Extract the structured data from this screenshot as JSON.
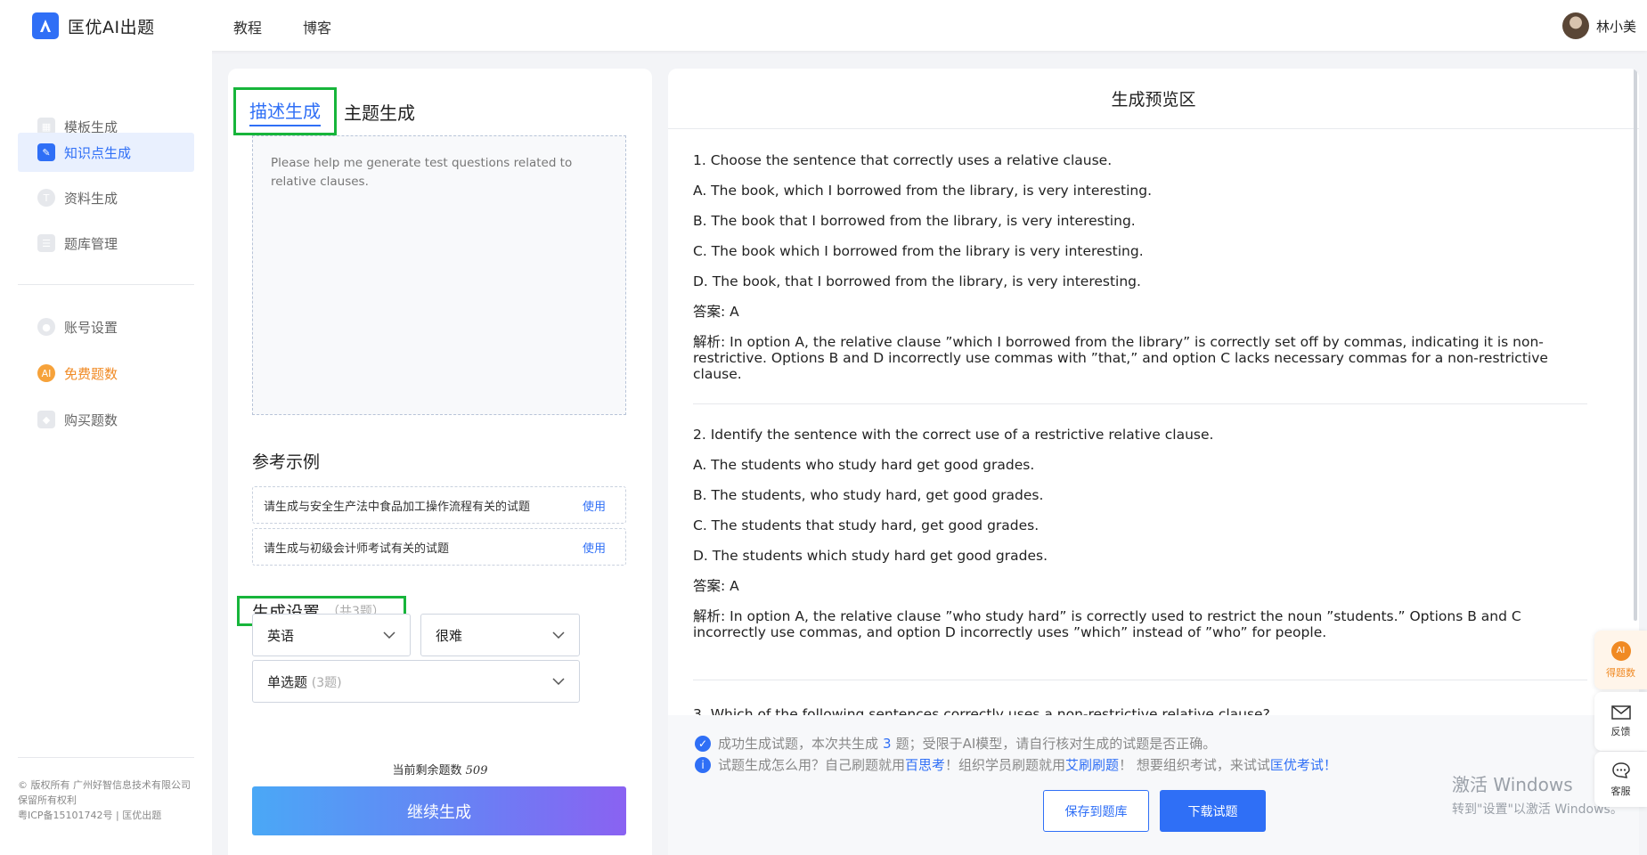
{
  "brand": {
    "name": "匡优AI出题",
    "color": "#2f6ff6"
  },
  "nav": {
    "items": [
      "教程",
      "博客"
    ]
  },
  "user": {
    "name": "林小美"
  },
  "sidebar": {
    "items": [
      {
        "label": "模板生成",
        "icon": "template-icon"
      },
      {
        "label": "知识点生成",
        "icon": "edit-icon"
      },
      {
        "label": "资料生成",
        "icon": "document-icon"
      },
      {
        "label": "题库管理",
        "icon": "database-icon"
      },
      {
        "label": "账号设置",
        "icon": "user-icon"
      },
      {
        "label": "免费题数",
        "icon": "ai-coin-icon"
      },
      {
        "label": "购买题数",
        "icon": "diamond-icon"
      }
    ],
    "copyright": [
      "© 版权所有 广州好智信息技术有限公司",
      "保留所有权利",
      "粤ICP备15101742号 | 匡优出题"
    ]
  },
  "left": {
    "tab_active": "描述生成",
    "tab_other": "主题生成",
    "description": "Please help me generate test questions related to relative clauses.",
    "examples_title": "参考示例",
    "examples": [
      {
        "text": "请生成与安全生产法中食品加工操作流程有关的试题",
        "action": "使用"
      },
      {
        "text": "请生成与初级会计师考试有关的试题",
        "action": "使用"
      }
    ],
    "settings_title": "生成设置",
    "settings_count": "（共3题）",
    "language": "英语",
    "difficulty": "很难",
    "qtype": "单选题",
    "qtype_count": "(3题)",
    "remain_label": "当前剩余题数",
    "remain_value": "509",
    "generate_button": "继续生成"
  },
  "preview": {
    "title": "生成预览区",
    "questions": [
      {
        "stem": "1. Choose the sentence that correctly uses a relative clause.",
        "options": [
          "A. The book, which I borrowed from the library, is very interesting.",
          "B. The book that I borrowed from the library, is very interesting.",
          "C. The book which I borrowed from the library is very interesting.",
          "D. The book, that I borrowed from the library, is very interesting."
        ],
        "answer": "答案: A",
        "explanation": "解析: In option A, the relative clause ”which I borrowed from the library” is correctly set off by commas, indicating it is non-restrictive. Options B and D incorrectly use commas with ”that,” and option C lacks necessary commas for a non-restrictive clause."
      },
      {
        "stem": "2. Identify the sentence with the correct use of a restrictive relative clause.",
        "options": [
          "A. The students who study hard get good grades.",
          "B. The students, who study hard, get good grades.",
          "C. The students that study hard, get good grades.",
          "D. The students which study hard get good grades."
        ],
        "answer": "答案: A",
        "explanation": "解析: In option A, the relative clause ”who study hard” is correctly used to restrict the noun ”students.” Options B and C incorrectly use commas, and option D incorrectly uses ”which” instead of ”who” for people."
      }
    ],
    "partial_line": "3. Which of the following sentences correctly uses a non-restrictive relative clause?"
  },
  "notes": {
    "success_a": "成功生成试题，本次共生成",
    "success_count": "3",
    "success_b": "题；受限于AI模型，请自行核对生成的试题是否正确。",
    "info_a": "试题生成怎么用？自己刷题就用",
    "info_link1": "百思考",
    "info_b": "！组织学员刷题就用",
    "info_link2": "艾刷刷题",
    "info_c": "！ 想要组织考试，来试试",
    "info_link3": "匡优考试",
    "info_d": "！"
  },
  "actions": {
    "save": "保存到题库",
    "download": "下载试题"
  },
  "watermark": {
    "line1": "激活 Windows",
    "line2": "转到\"设置\"以激活 Windows。"
  },
  "float": {
    "ai_label": "得题数",
    "feedback": "反馈",
    "service": "客服"
  }
}
